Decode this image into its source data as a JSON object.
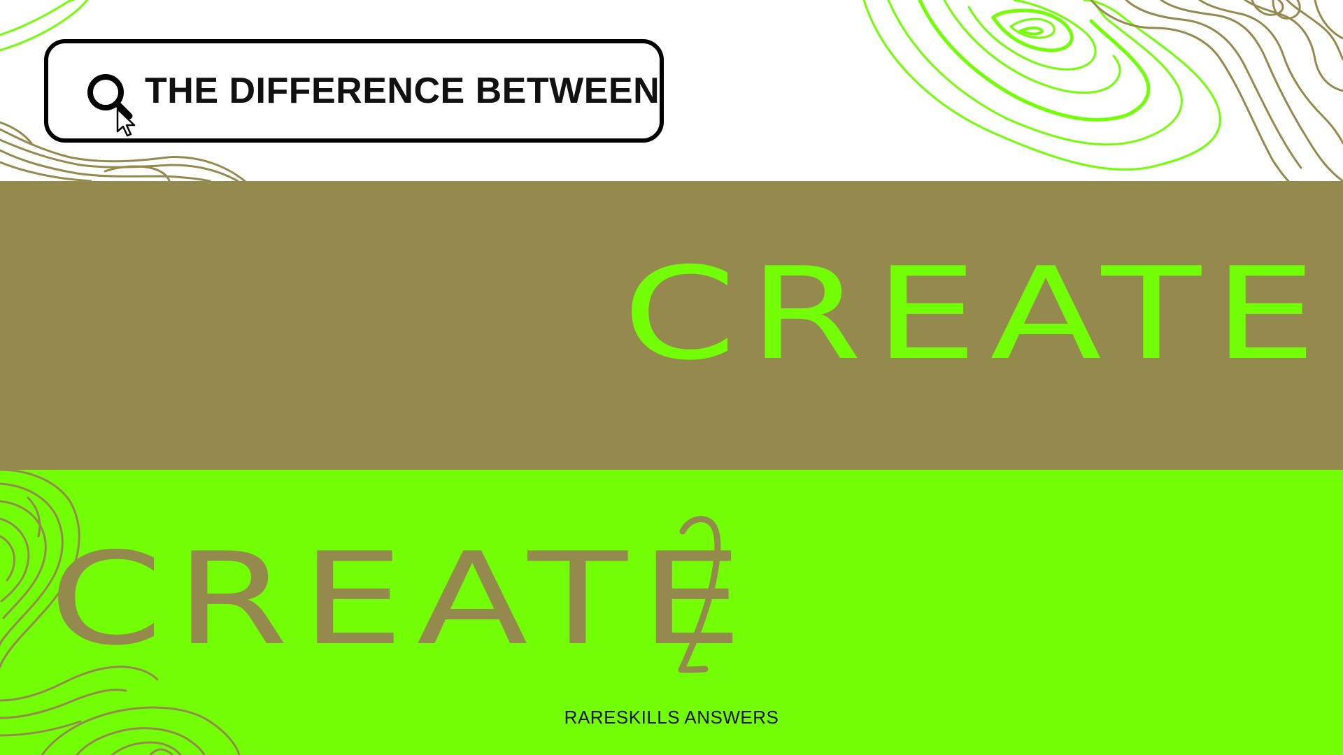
{
  "search_bar": {
    "query": "THE DIFFERENCE BETWEEN",
    "icon": "search-icon"
  },
  "cursor": {
    "icon": "pointer-cursor-icon"
  },
  "words": {
    "first": "CREATE",
    "second": "CREATE"
  },
  "swash": {
    "icon": "numeral-two-swash-icon"
  },
  "footer": {
    "label": "RARESKILLS ANSWERS"
  },
  "colors": {
    "neon_green": "#72ff05",
    "olive": "#948a4d",
    "white": "#ffffff",
    "black": "#000000"
  }
}
